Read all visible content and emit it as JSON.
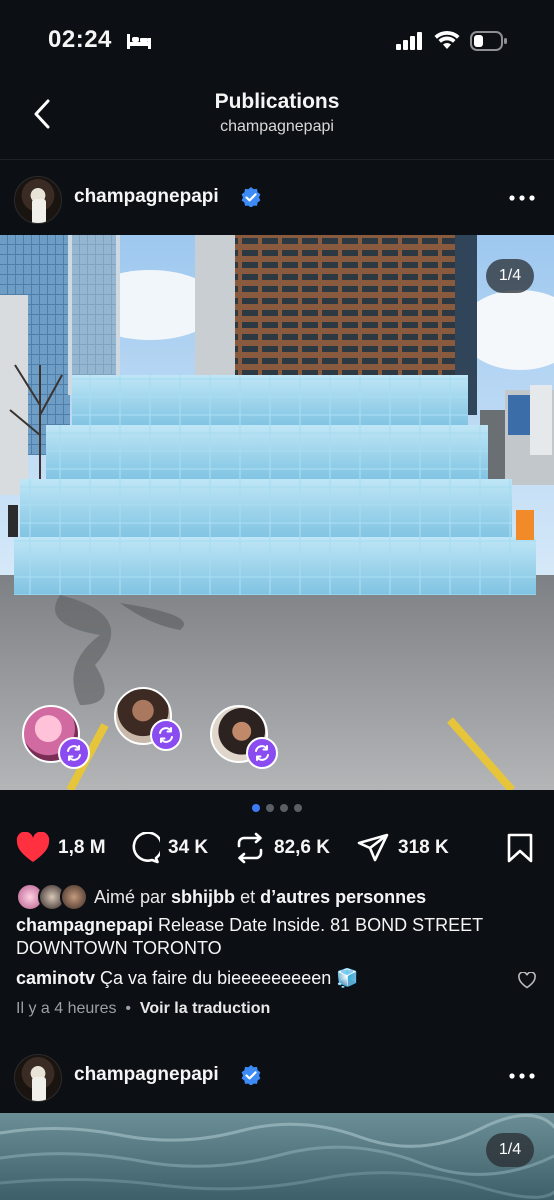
{
  "status": {
    "time": "02:24"
  },
  "nav": {
    "title": "Publications",
    "subtitle": "champagnepapi"
  },
  "post1": {
    "username": "champagnepapi",
    "counter": "1/4",
    "likes": "1,8 M",
    "comments": "34 K",
    "reposts": "82,6 K",
    "shares": "318 K",
    "liked_prefix": "Aimé par",
    "liked_user": "sbhijbb",
    "liked_and": "et",
    "liked_rest": "d’autres personnes",
    "caption_user": "champagnepapi",
    "caption_text": "Release Date Inside. 81 BOND STREET DOWNTOWN TORONTO",
    "comment_user": "caminotv",
    "comment_text": "Ça va faire du bieeeeeeeeen 🧊",
    "time_ago": "Il y a 4 heures",
    "translate": "Voir la traduction"
  },
  "post2": {
    "username": "champagnepapi",
    "counter": "1/4"
  },
  "colors": {
    "like_red": "#ff3040",
    "verified_blue": "#3d8bf7",
    "repost_purple": "#8a4cf0",
    "background": "#0c0f14"
  }
}
